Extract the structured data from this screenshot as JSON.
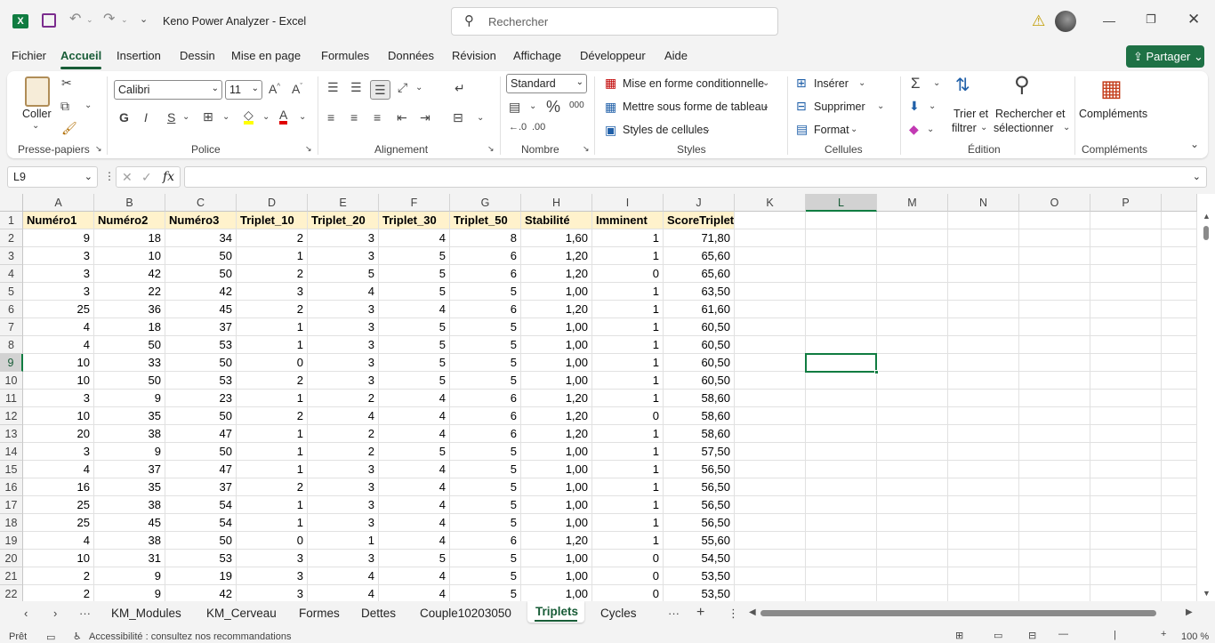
{
  "title": {
    "text": "Keno Power Analyzer  -  Excel",
    "search_placeholder": "Rechercher"
  },
  "menu": [
    "Fichier",
    "Accueil",
    "Insertion",
    "Dessin",
    "Mise en page",
    "Formules",
    "Données",
    "Révision",
    "Affichage",
    "Développeur",
    "Aide"
  ],
  "share_label": "Partager",
  "ribbon": {
    "paste": "Coller",
    "clipboard": "Presse-papiers",
    "font_name": "Calibri",
    "font_size": "11",
    "bold": "G",
    "italic": "I",
    "underline": "S",
    "font_group": "Police",
    "align_group": "Alignement",
    "number_format": "Standard",
    "number_group": "Nombre",
    "cond_format": "Mise en forme conditionnelle",
    "format_table": "Mettre sous forme de tableau",
    "cell_styles": "Styles de cellules",
    "styles_group": "Styles",
    "insert": "Insérer",
    "delete": "Supprimer",
    "format": "Format",
    "cells_group": "Cellules",
    "sort1": "Trier et",
    "sort2": "filtrer",
    "find1": "Rechercher et",
    "find2": "sélectionner",
    "edit_group": "Édition",
    "addins": "Compléments",
    "addins_group": "Compléments"
  },
  "namebox": "L9",
  "fx": "fx",
  "columns": [
    "A",
    "B",
    "C",
    "D",
    "E",
    "F",
    "G",
    "H",
    "I",
    "J",
    "K",
    "L",
    "M",
    "N",
    "O",
    "P"
  ],
  "headers": [
    "Numéro1",
    "Numéro2",
    "Numéro3",
    "Triplet_10",
    "Triplet_20",
    "Triplet_30",
    "Triplet_50",
    "Stabilité",
    "Imminent",
    "ScoreTriplet"
  ],
  "rows": [
    [
      "9",
      "18",
      "34",
      "2",
      "3",
      "4",
      "8",
      "1,60",
      "1",
      "71,80"
    ],
    [
      "3",
      "10",
      "50",
      "1",
      "3",
      "5",
      "6",
      "1,20",
      "1",
      "65,60"
    ],
    [
      "3",
      "42",
      "50",
      "2",
      "5",
      "5",
      "6",
      "1,20",
      "0",
      "65,60"
    ],
    [
      "3",
      "22",
      "42",
      "3",
      "4",
      "5",
      "5",
      "1,00",
      "1",
      "63,50"
    ],
    [
      "25",
      "36",
      "45",
      "2",
      "3",
      "4",
      "6",
      "1,20",
      "1",
      "61,60"
    ],
    [
      "4",
      "18",
      "37",
      "1",
      "3",
      "5",
      "5",
      "1,00",
      "1",
      "60,50"
    ],
    [
      "4",
      "50",
      "53",
      "1",
      "3",
      "5",
      "5",
      "1,00",
      "1",
      "60,50"
    ],
    [
      "10",
      "33",
      "50",
      "0",
      "3",
      "5",
      "5",
      "1,00",
      "1",
      "60,50"
    ],
    [
      "10",
      "50",
      "53",
      "2",
      "3",
      "5",
      "5",
      "1,00",
      "1",
      "60,50"
    ],
    [
      "3",
      "9",
      "23",
      "1",
      "2",
      "4",
      "6",
      "1,20",
      "1",
      "58,60"
    ],
    [
      "10",
      "35",
      "50",
      "2",
      "4",
      "4",
      "6",
      "1,20",
      "0",
      "58,60"
    ],
    [
      "20",
      "38",
      "47",
      "1",
      "2",
      "4",
      "6",
      "1,20",
      "1",
      "58,60"
    ],
    [
      "3",
      "9",
      "50",
      "1",
      "2",
      "5",
      "5",
      "1,00",
      "1",
      "57,50"
    ],
    [
      "4",
      "37",
      "47",
      "1",
      "3",
      "4",
      "5",
      "1,00",
      "1",
      "56,50"
    ],
    [
      "16",
      "35",
      "37",
      "2",
      "3",
      "4",
      "5",
      "1,00",
      "1",
      "56,50"
    ],
    [
      "25",
      "38",
      "54",
      "1",
      "3",
      "4",
      "5",
      "1,00",
      "1",
      "56,50"
    ],
    [
      "25",
      "45",
      "54",
      "1",
      "3",
      "4",
      "5",
      "1,00",
      "1",
      "56,50"
    ],
    [
      "4",
      "38",
      "50",
      "0",
      "1",
      "4",
      "6",
      "1,20",
      "1",
      "55,60"
    ],
    [
      "10",
      "31",
      "53",
      "3",
      "3",
      "5",
      "5",
      "1,00",
      "0",
      "54,50"
    ],
    [
      "2",
      "9",
      "19",
      "3",
      "4",
      "4",
      "5",
      "1,00",
      "0",
      "53,50"
    ],
    [
      "2",
      "9",
      "42",
      "3",
      "4",
      "4",
      "5",
      "1,00",
      "0",
      "53,50"
    ]
  ],
  "sheets": [
    "KM_Modules",
    "KM_Cerveau",
    "Formes",
    "Dettes",
    "Couple10203050",
    "Triplets",
    "Cycles"
  ],
  "active_sheet": "Triplets",
  "status": {
    "mode": "Prêt",
    "accessibility": "Accessibilité : consultez nos recommandations",
    "zoom": "100 %"
  },
  "colors": {
    "accent": "#185c37",
    "header_fill": "#fff2cc",
    "share_bg": "#1e7145"
  }
}
